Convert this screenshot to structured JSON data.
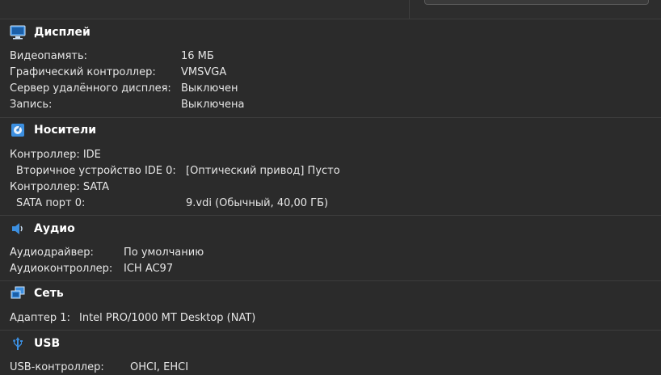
{
  "display": {
    "title": "Дисплей",
    "rows": [
      {
        "label": "Видеопамять:",
        "value": "16 МБ"
      },
      {
        "label": "Графический контроллер:",
        "value": "VMSVGA"
      },
      {
        "label": "Сервер удалённого дисплея:",
        "value": "Выключен"
      },
      {
        "label": "Запись:",
        "value": "Выключена"
      }
    ]
  },
  "storage": {
    "title": "Носители",
    "rows": [
      {
        "label": "Контроллер: IDE",
        "value": ""
      },
      {
        "label": "Вторичное устройство IDE 0:",
        "value": "[Оптический привод] Пусто"
      },
      {
        "label": "Контроллер: SATA",
        "value": ""
      },
      {
        "label": "SATA порт 0:",
        "value": "9.vdi (Обычный, 40,00 ГБ)"
      }
    ]
  },
  "audio": {
    "title": "Аудио",
    "rows": [
      {
        "label": "Аудиодрайвер:",
        "value": "По умолчанию"
      },
      {
        "label": "Аудиоконтроллер:",
        "value": "ICH AC97"
      }
    ]
  },
  "network": {
    "title": "Сеть",
    "rows": [
      {
        "label": "Адаптер 1:",
        "value": "Intel PRO/1000 MT Desktop (NAT)"
      }
    ]
  },
  "usb": {
    "title": "USB",
    "rows": [
      {
        "label": "USB-контроллер:",
        "value": "OHCI, EHCI"
      }
    ]
  },
  "colors": {
    "background": "#2b2b2b",
    "text": "#e6e6e6",
    "header_text": "#ffffff",
    "icon_blue": "#3c8fe0"
  }
}
